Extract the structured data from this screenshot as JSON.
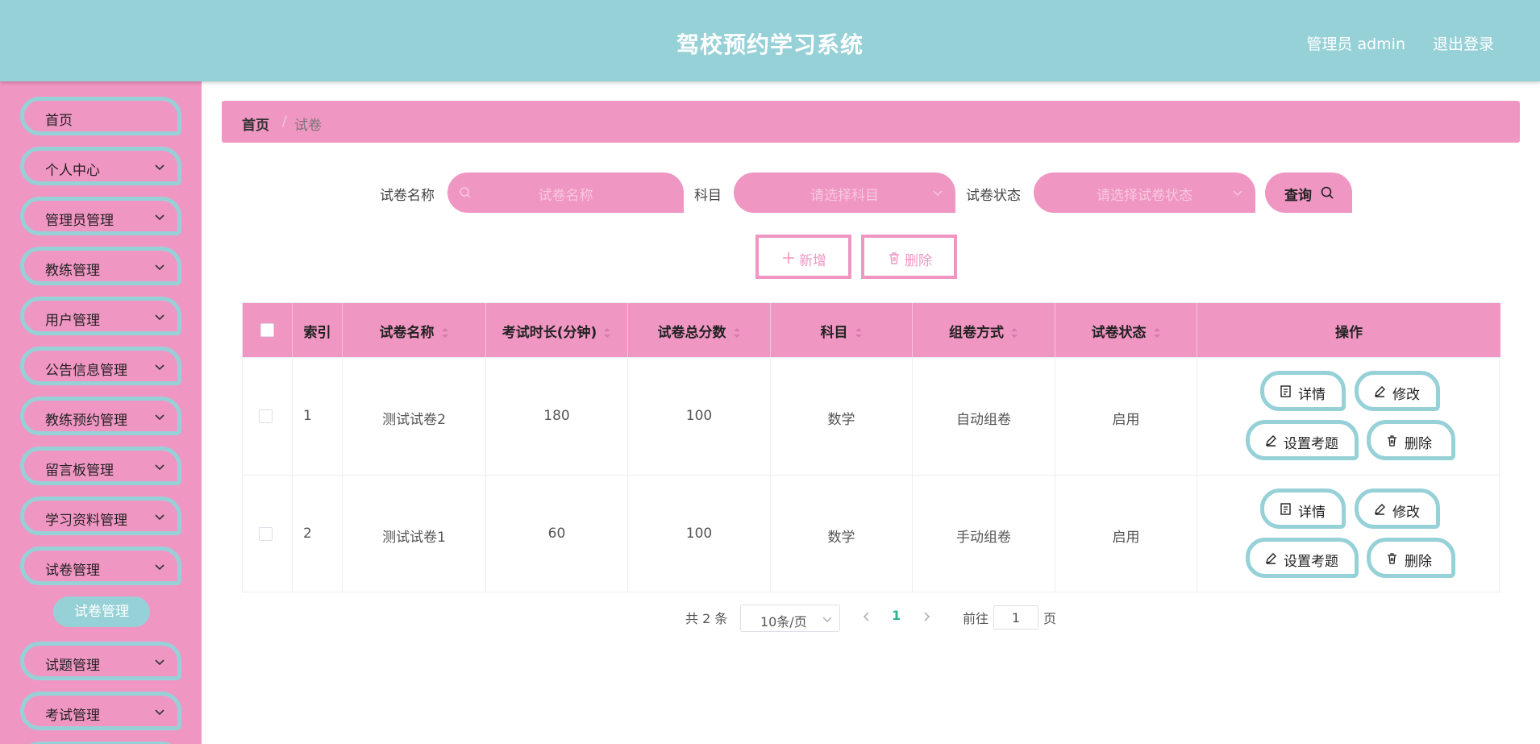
{
  "app": {
    "title": "驾校预约学习系统",
    "user": "管理员 admin",
    "logout": "退出登录"
  },
  "sidebar": {
    "items": [
      {
        "label": "首页",
        "expandable": false
      },
      {
        "label": "个人中心",
        "expandable": true
      },
      {
        "label": "管理员管理",
        "expandable": true
      },
      {
        "label": "教练管理",
        "expandable": true
      },
      {
        "label": "用户管理",
        "expandable": true
      },
      {
        "label": "公告信息管理",
        "expandable": true
      },
      {
        "label": "教练预约管理",
        "expandable": true
      },
      {
        "label": "留言板管理",
        "expandable": true
      },
      {
        "label": "学习资料管理",
        "expandable": true
      },
      {
        "label": "试卷管理",
        "expandable": true
      },
      {
        "label": "试题管理",
        "expandable": true
      },
      {
        "label": "考试管理",
        "expandable": true
      }
    ],
    "active_sub": "试卷管理"
  },
  "breadcrumb": {
    "home": "首页",
    "separator": "/",
    "current": "试卷"
  },
  "search": {
    "name_label": "试卷名称",
    "name_placeholder": "试卷名称",
    "subject_label": "科目",
    "subject_placeholder": "请选择科目",
    "status_label": "试卷状态",
    "status_placeholder": "请选择试卷状态",
    "query_label": "查询"
  },
  "actions": {
    "add_label": "新增",
    "delete_label": "删除"
  },
  "table": {
    "headers": [
      "",
      "索引",
      "试卷名称",
      "考试时长(分钟)",
      "试卷总分数",
      "科目",
      "组卷方式",
      "试卷状态",
      "操作"
    ],
    "rows": [
      {
        "index": "1",
        "name": "测试试卷2",
        "duration": "180",
        "score": "100",
        "subject": "数学",
        "method": "自动组卷",
        "status": "启用"
      },
      {
        "index": "2",
        "name": "测试试卷1",
        "duration": "60",
        "score": "100",
        "subject": "数学",
        "method": "手动组卷",
        "status": "启用"
      }
    ],
    "op_labels": {
      "detail": "详情",
      "edit": "修改",
      "set_questions": "设置考题",
      "delete": "删除"
    }
  },
  "pagination": {
    "total": "共 2 条",
    "page_size": "10条/页",
    "current_page": "1",
    "goto_label": "前往",
    "goto_value": "1",
    "page_suffix": "页"
  },
  "colors": {
    "header_bg": "#97d1d8",
    "sidebar_bg": "#f096c3",
    "accent_pink": "#f096c3",
    "accent_teal": "#97d1d8",
    "pager_active": "#2bb48e"
  }
}
